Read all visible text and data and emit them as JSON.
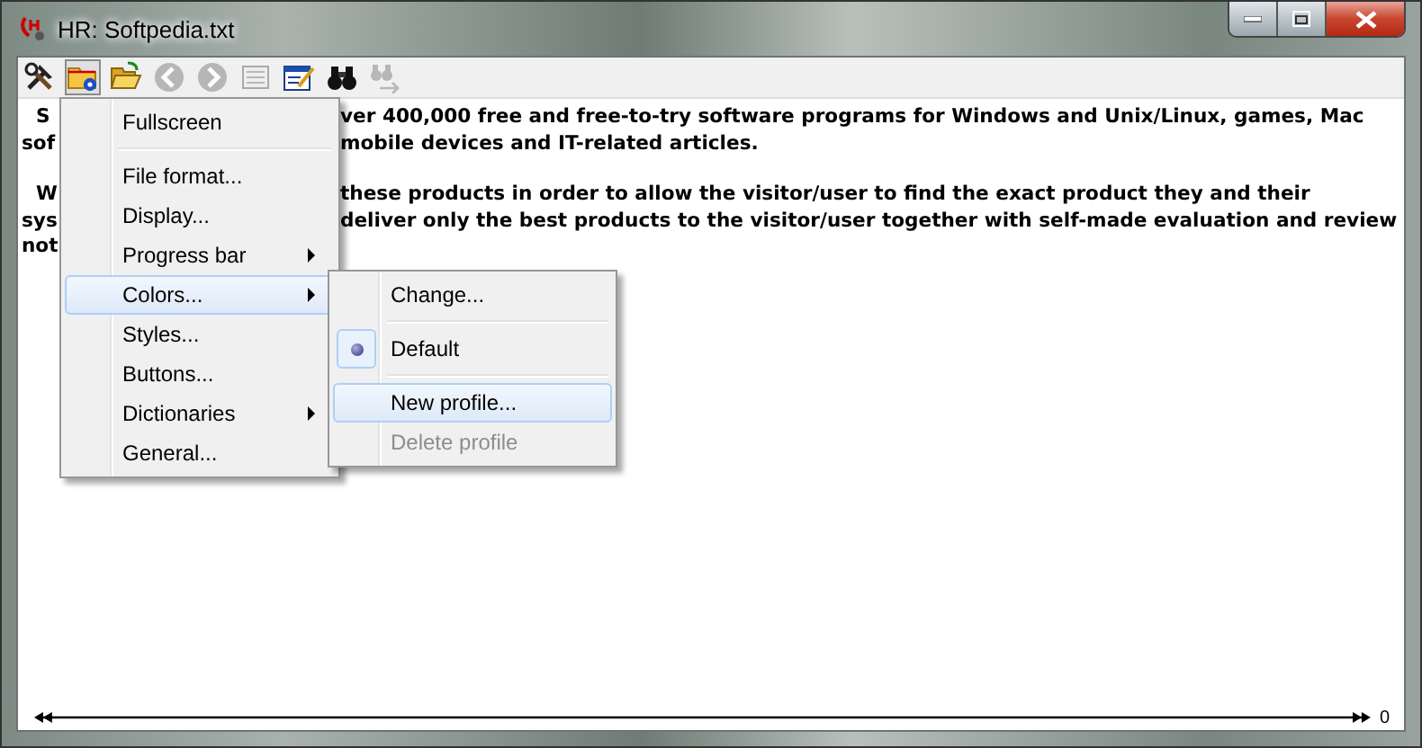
{
  "window": {
    "title": "HR: Softpedia.txt"
  },
  "toolbar": [
    {
      "kind": "tools",
      "disabled": false,
      "pressed": false
    },
    {
      "kind": "folder-gear",
      "disabled": false,
      "pressed": true
    },
    {
      "kind": "folder-open",
      "disabled": false,
      "pressed": false
    },
    {
      "kind": "back",
      "disabled": true,
      "pressed": false
    },
    {
      "kind": "forward",
      "disabled": true,
      "pressed": false
    },
    {
      "kind": "list",
      "disabled": true,
      "pressed": false
    },
    {
      "kind": "edit",
      "disabled": false,
      "pressed": false
    },
    {
      "kind": "binoculars",
      "disabled": false,
      "pressed": false
    },
    {
      "kind": "find-next",
      "disabled": true,
      "pressed": false
    }
  ],
  "paragraphs": [
    {
      "lines": [
        {
          "left": "S",
          "right": "ver 400,000 free and free-to-try software programs for Windows and Unix/Linux, games, Mac"
        },
        {
          "left": "sof",
          "right": "mobile devices and IT-related articles."
        }
      ]
    },
    {
      "lines": [
        {
          "left": "W",
          "right": "these products in order to allow the visitor/user to find the exact product they and their"
        },
        {
          "left": "sys",
          "right": "deliver only the best products to the visitor/user together with self-made evaluation and review"
        },
        {
          "left": "not"
        }
      ]
    }
  ],
  "menu": {
    "items": [
      {
        "kind": "item",
        "label": "Fullscreen",
        "submenu": false,
        "selected": false
      },
      {
        "kind": "separator"
      },
      {
        "kind": "item",
        "label": "File format...",
        "submenu": false,
        "selected": false
      },
      {
        "kind": "item",
        "label": "Display...",
        "submenu": false,
        "selected": false
      },
      {
        "kind": "item",
        "label": "Progress bar",
        "submenu": true,
        "selected": false
      },
      {
        "kind": "item",
        "label": "Colors...",
        "submenu": true,
        "selected": true
      },
      {
        "kind": "item",
        "label": "Styles...",
        "submenu": false,
        "selected": false
      },
      {
        "kind": "item",
        "label": "Buttons...",
        "submenu": false,
        "selected": false
      },
      {
        "kind": "item",
        "label": "Dictionaries",
        "submenu": true,
        "selected": false
      },
      {
        "kind": "item",
        "label": "General...",
        "submenu": false,
        "selected": false
      }
    ]
  },
  "submenu": {
    "items": [
      {
        "kind": "item",
        "label": "Change...",
        "selected": false,
        "disabled": false
      },
      {
        "kind": "separator"
      },
      {
        "kind": "radio",
        "label": "Default",
        "checked": true,
        "selected": false,
        "disabled": false
      },
      {
        "kind": "separator"
      },
      {
        "kind": "item",
        "label": "New profile...",
        "selected": true,
        "disabled": false
      },
      {
        "kind": "item",
        "label": "Delete profile",
        "selected": false,
        "disabled": true
      }
    ]
  },
  "progress": {
    "reading": "0"
  }
}
